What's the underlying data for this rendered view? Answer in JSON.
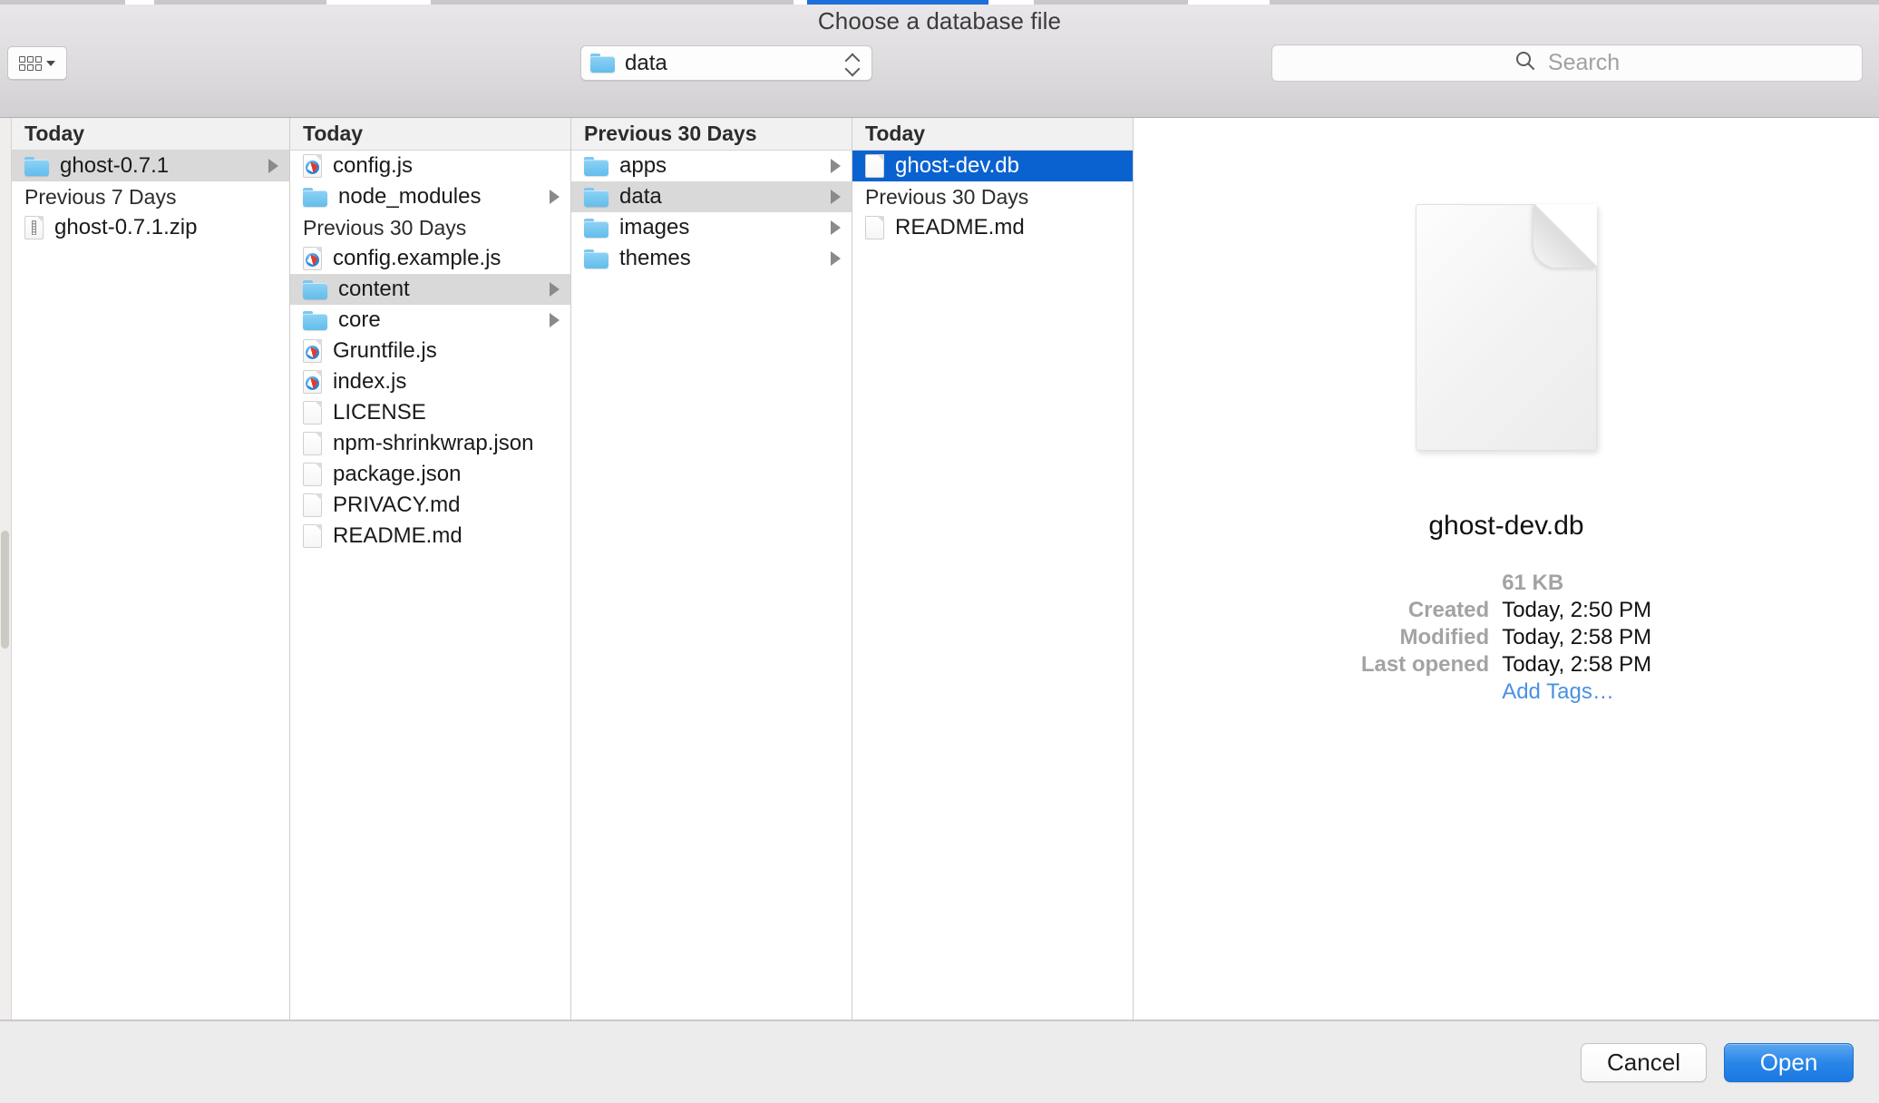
{
  "window": {
    "title": "Choose a database file"
  },
  "toolbar": {
    "view_mode_icon": "icon-grid-view-icon",
    "view_mode_chevron_icon": "chevron-down-icon",
    "path_popup": {
      "value": "data",
      "folder_icon": "folder-icon",
      "stepper_icon": "up-down-stepper-icon"
    },
    "search": {
      "placeholder": "Search",
      "value": "",
      "icon": "search-icon"
    }
  },
  "columns": [
    {
      "header": "Today",
      "sections": [
        {
          "label": null,
          "items": [
            {
              "name": "ghost-0.7.1",
              "icon": "folder-icon",
              "kind": "folder",
              "has_children": true,
              "selected": "inactive"
            }
          ]
        },
        {
          "label": "Previous 7 Days",
          "items": [
            {
              "name": "ghost-0.7.1.zip",
              "icon": "zip-file-icon",
              "kind": "file",
              "has_children": false,
              "selected": "none"
            }
          ]
        }
      ]
    },
    {
      "header": "Today",
      "sections": [
        {
          "label": null,
          "items": [
            {
              "name": "config.js",
              "icon": "js-file-icon",
              "kind": "file",
              "has_children": false,
              "selected": "none"
            },
            {
              "name": "node_modules",
              "icon": "folder-icon",
              "kind": "folder",
              "has_children": true,
              "selected": "none"
            }
          ]
        },
        {
          "label": "Previous 30 Days",
          "items": [
            {
              "name": "config.example.js",
              "icon": "js-file-icon",
              "kind": "file",
              "has_children": false,
              "selected": "none"
            },
            {
              "name": "content",
              "icon": "folder-icon",
              "kind": "folder",
              "has_children": true,
              "selected": "inactive"
            },
            {
              "name": "core",
              "icon": "folder-icon",
              "kind": "folder",
              "has_children": true,
              "selected": "none"
            },
            {
              "name": "Gruntfile.js",
              "icon": "js-file-icon",
              "kind": "file",
              "has_children": false,
              "selected": "none"
            },
            {
              "name": "index.js",
              "icon": "js-file-icon",
              "kind": "file",
              "has_children": false,
              "selected": "none"
            },
            {
              "name": "LICENSE",
              "icon": "document-icon",
              "kind": "file",
              "has_children": false,
              "selected": "none"
            },
            {
              "name": "npm-shrinkwrap.json",
              "icon": "document-icon",
              "kind": "file",
              "has_children": false,
              "selected": "none"
            },
            {
              "name": "package.json",
              "icon": "document-icon",
              "kind": "file",
              "has_children": false,
              "selected": "none"
            },
            {
              "name": "PRIVACY.md",
              "icon": "document-icon",
              "kind": "file",
              "has_children": false,
              "selected": "none"
            },
            {
              "name": "README.md",
              "icon": "document-icon",
              "kind": "file",
              "has_children": false,
              "selected": "none"
            }
          ]
        }
      ]
    },
    {
      "header": "Previous 30 Days",
      "sections": [
        {
          "label": null,
          "items": [
            {
              "name": "apps",
              "icon": "folder-icon",
              "kind": "folder",
              "has_children": true,
              "selected": "none"
            },
            {
              "name": "data",
              "icon": "folder-icon",
              "kind": "folder",
              "has_children": true,
              "selected": "inactive"
            },
            {
              "name": "images",
              "icon": "folder-icon",
              "kind": "folder",
              "has_children": true,
              "selected": "none"
            },
            {
              "name": "themes",
              "icon": "folder-icon",
              "kind": "folder",
              "has_children": true,
              "selected": "none"
            }
          ]
        }
      ]
    },
    {
      "header": "Today",
      "sections": [
        {
          "label": null,
          "items": [
            {
              "name": "ghost-dev.db",
              "icon": "document-icon",
              "kind": "file",
              "has_children": false,
              "selected": "active"
            }
          ]
        },
        {
          "label": "Previous 30 Days",
          "items": [
            {
              "name": "README.md",
              "icon": "document-icon",
              "kind": "file",
              "has_children": false,
              "selected": "none"
            }
          ]
        }
      ]
    }
  ],
  "preview": {
    "icon": "large-document-icon",
    "filename": "ghost-dev.db",
    "size": "61 KB",
    "fields": [
      {
        "label": "Created",
        "value": "Today, 2:50 PM"
      },
      {
        "label": "Modified",
        "value": "Today, 2:58 PM"
      },
      {
        "label": "Last opened",
        "value": "Today, 2:58 PM"
      }
    ],
    "add_tags_label": "Add Tags…"
  },
  "footer": {
    "cancel_label": "Cancel",
    "open_label": "Open"
  },
  "colors": {
    "selection_active": "#0a62d0",
    "selection_inactive": "#d9d9d9",
    "accent_link": "#4a90e2",
    "open_button": "#2a86e8"
  }
}
